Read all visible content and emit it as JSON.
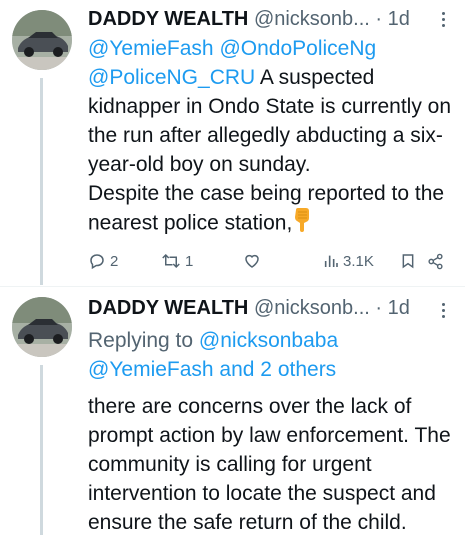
{
  "tweets": [
    {
      "display_name": "DADDY WEALTH",
      "handle": "@nicksonb...",
      "separator": "·",
      "time": "1d",
      "mentions": [
        "@YemieFash",
        "@OndoPoliceNg",
        "@PoliceNG_CRU"
      ],
      "text": "A suspected kidnapper in Ondo State is currently on the run after allegedly abducting a six-year-old boy on sunday.",
      "text2": "Despite the case being reported to the nearest police station,",
      "emoji": "pointing-down-emoji",
      "stats": {
        "replies": "2",
        "retweets": "1",
        "views": "3.1K"
      }
    },
    {
      "display_name": "DADDY WEALTH",
      "handle": "@nicksonb...",
      "separator": "·",
      "time": "1d",
      "replying_label": "Replying to",
      "replying_handle": "@nicksonbaba",
      "replying_others": "@YemieFash and 2 others",
      "text": "there are concerns over the lack of prompt action by law enforcement. The community is calling for urgent intervention to locate the suspect and ensure the safe return of the child."
    }
  ],
  "icons": {
    "reply": "reply-icon",
    "retweet": "retweet-icon",
    "like": "heart-icon",
    "views": "views-chart-icon",
    "bookmark": "bookmark-icon",
    "share": "share-icon",
    "more": "more-vertical-icon"
  },
  "colors": {
    "accent": "#1d9bf0",
    "secondary_text": "#536471",
    "emoji": "#f7a928"
  }
}
